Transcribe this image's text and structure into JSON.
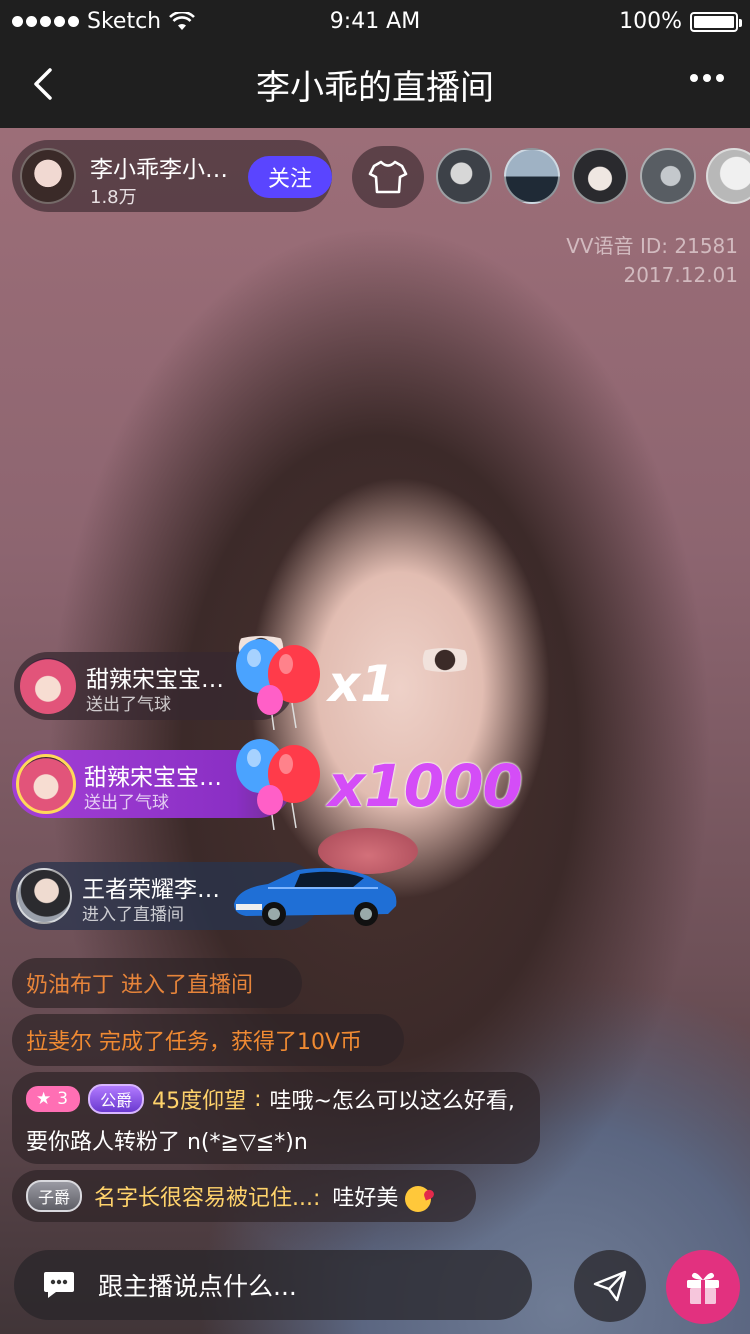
{
  "status": {
    "carrier": "Sketch",
    "time": "9:41 AM",
    "battery": "100%"
  },
  "nav": {
    "title": "李小乖的直播间"
  },
  "host": {
    "name": "李小乖李小乖李小乖",
    "fans": "1.8万",
    "follow_label": "关注"
  },
  "watermark": {
    "line1": "VV语音 ID: 21581",
    "line2": "2017.12.01"
  },
  "gifts": [
    {
      "name": "甜辣宋宝宝宝宝",
      "action": "送出了气球",
      "multiplier": "x1"
    },
    {
      "name": "甜辣宋宝宝宝宝",
      "action": "送出了气球",
      "multiplier": "x1000"
    }
  ],
  "entry": {
    "name": "王者荣耀李白白",
    "action": "进入了直播间"
  },
  "chat": {
    "m1": {
      "user": "奶油布丁",
      "text": "进入了直播间"
    },
    "m2": {
      "user": "拉斐尔",
      "text": "完成了任务，获得了10V币"
    },
    "m3": {
      "level": "3",
      "medal": "公爵",
      "user": "45度仰望",
      "sep": ":",
      "text1": "哇哦~怎么可以这么好看,",
      "text2": "要你路人转粉了 n(*≧▽≦*)n"
    },
    "m4": {
      "medal": "子爵",
      "user": "名字长很容易被记住...",
      "sep": ":",
      "text": "哇好美"
    }
  },
  "input": {
    "placeholder": "跟主播说点什么..."
  },
  "colors": {
    "follow": "#5a45ff",
    "gift_purple": "#a33fd6",
    "gift_button": "#e2317f",
    "system_orange": "#f08a32",
    "username_yellow": "#ffd36b"
  }
}
